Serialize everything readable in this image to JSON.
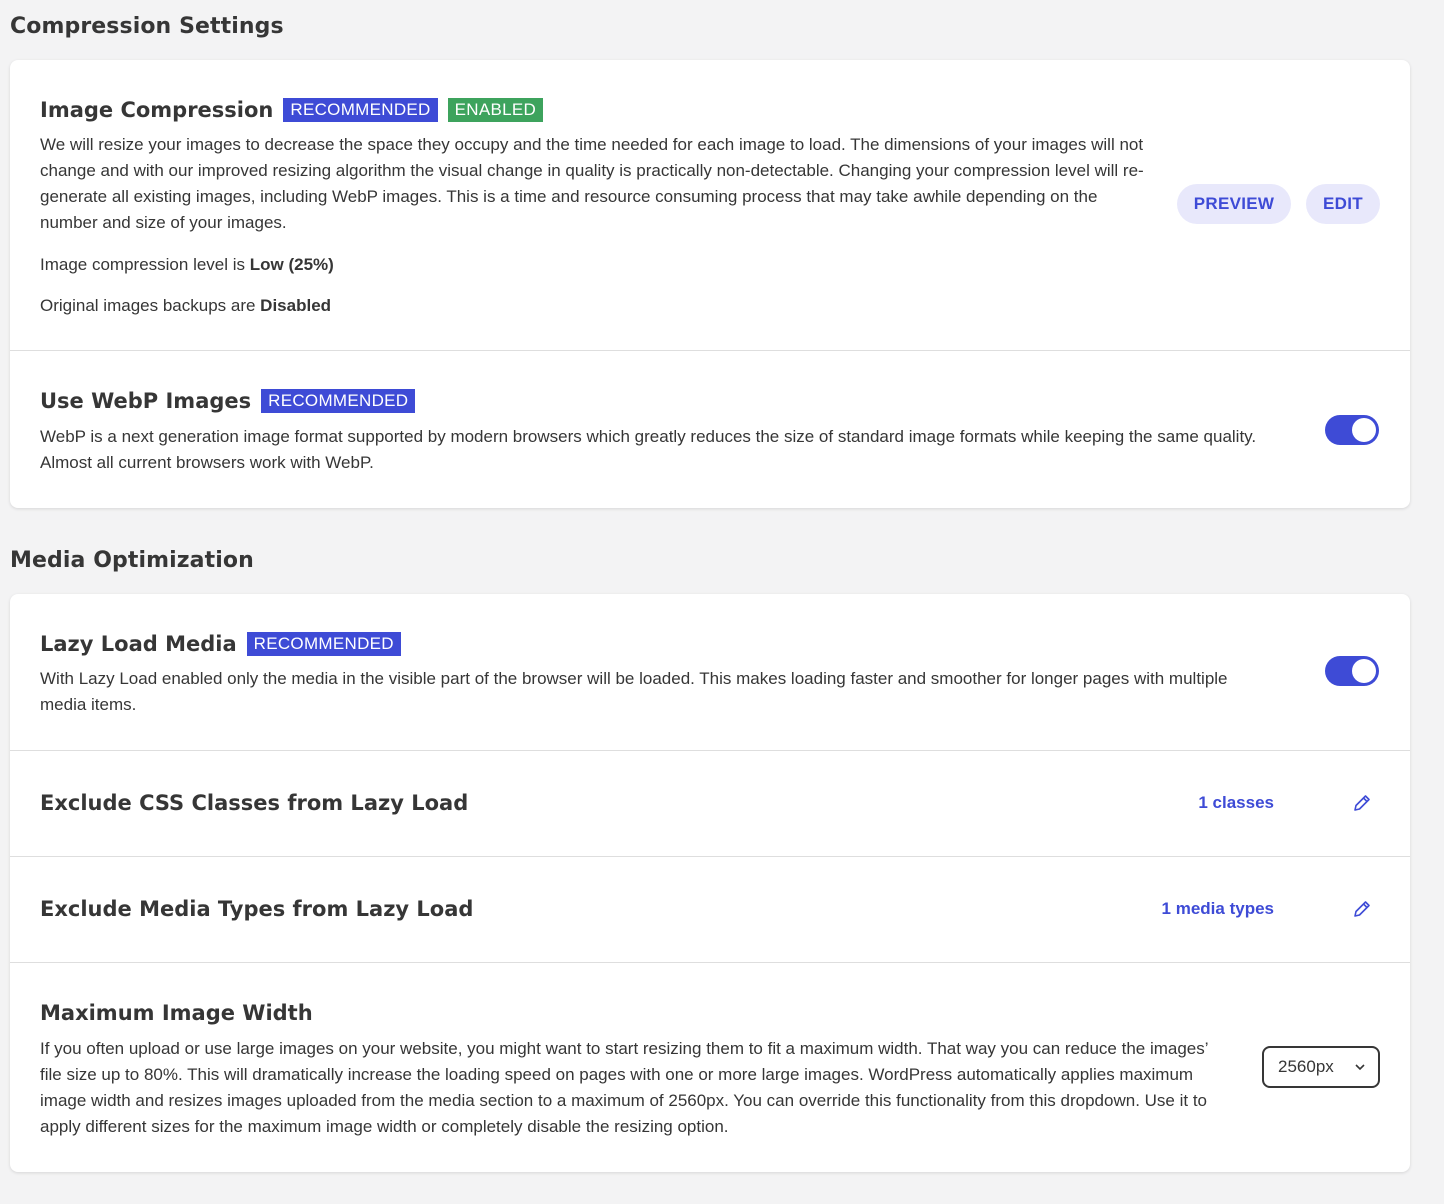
{
  "compression": {
    "section_title": "Compression Settings",
    "image_compression": {
      "title": "Image Compression",
      "badge_recommended": "RECOMMENDED",
      "badge_enabled": "ENABLED",
      "description": "We will resize your images to decrease the space they occupy and the time needed for each image to load. The dimensions of your images will not change and with our improved resizing algorithm the visual change in quality is practically non-detectable. Changing your compression level will re-generate all existing images, including WebP images. This is a time and resource consuming process that may take awhile depending on the number and size of your images.",
      "level_prefix": "Image compression level is ",
      "level_value": "Low (25%)",
      "backup_prefix": "Original images backups are ",
      "backup_value": "Disabled",
      "preview_label": "PREVIEW",
      "edit_label": "EDIT"
    },
    "webp": {
      "title": "Use WebP Images",
      "badge_recommended": "RECOMMENDED",
      "description": "WebP is a next generation image format supported by modern browsers which greatly reduces the size of standard image formats while keeping the same quality. Almost all current browsers work with WebP.",
      "enabled": true
    }
  },
  "media": {
    "section_title": "Media Optimization",
    "lazy_load": {
      "title": "Lazy Load Media",
      "badge_recommended": "RECOMMENDED",
      "description": "With Lazy Load enabled only the media in the visible part of the browser will be loaded. This makes loading faster and smoother for longer pages with multiple media items.",
      "enabled": true
    },
    "exclude_css": {
      "title": "Exclude CSS Classes from Lazy Load",
      "count_label": "1 classes",
      "icon": "pencil-icon"
    },
    "exclude_media": {
      "title": "Exclude Media Types from Lazy Load",
      "count_label": "1 media types",
      "icon": "pencil-icon"
    },
    "max_width": {
      "title": "Maximum Image Width",
      "description": "If you often upload or use large images on your website, you might want to start resizing them to fit a maximum width. That way you can reduce the images’ file size up to 80%. This will dramatically increase the loading speed on pages with one or more large images. WordPress automatically applies maximum image width and resizes images uploaded from the media section to a maximum of 2560px. You can override this functionality from this dropdown. Use it to apply different sizes for the maximum image width or completely disable the resizing option.",
      "selected_value": "2560px"
    }
  },
  "colors": {
    "accent": "#3e4bd6",
    "enabled_green": "#3da35d",
    "pill_bg": "#e8e8fb"
  }
}
